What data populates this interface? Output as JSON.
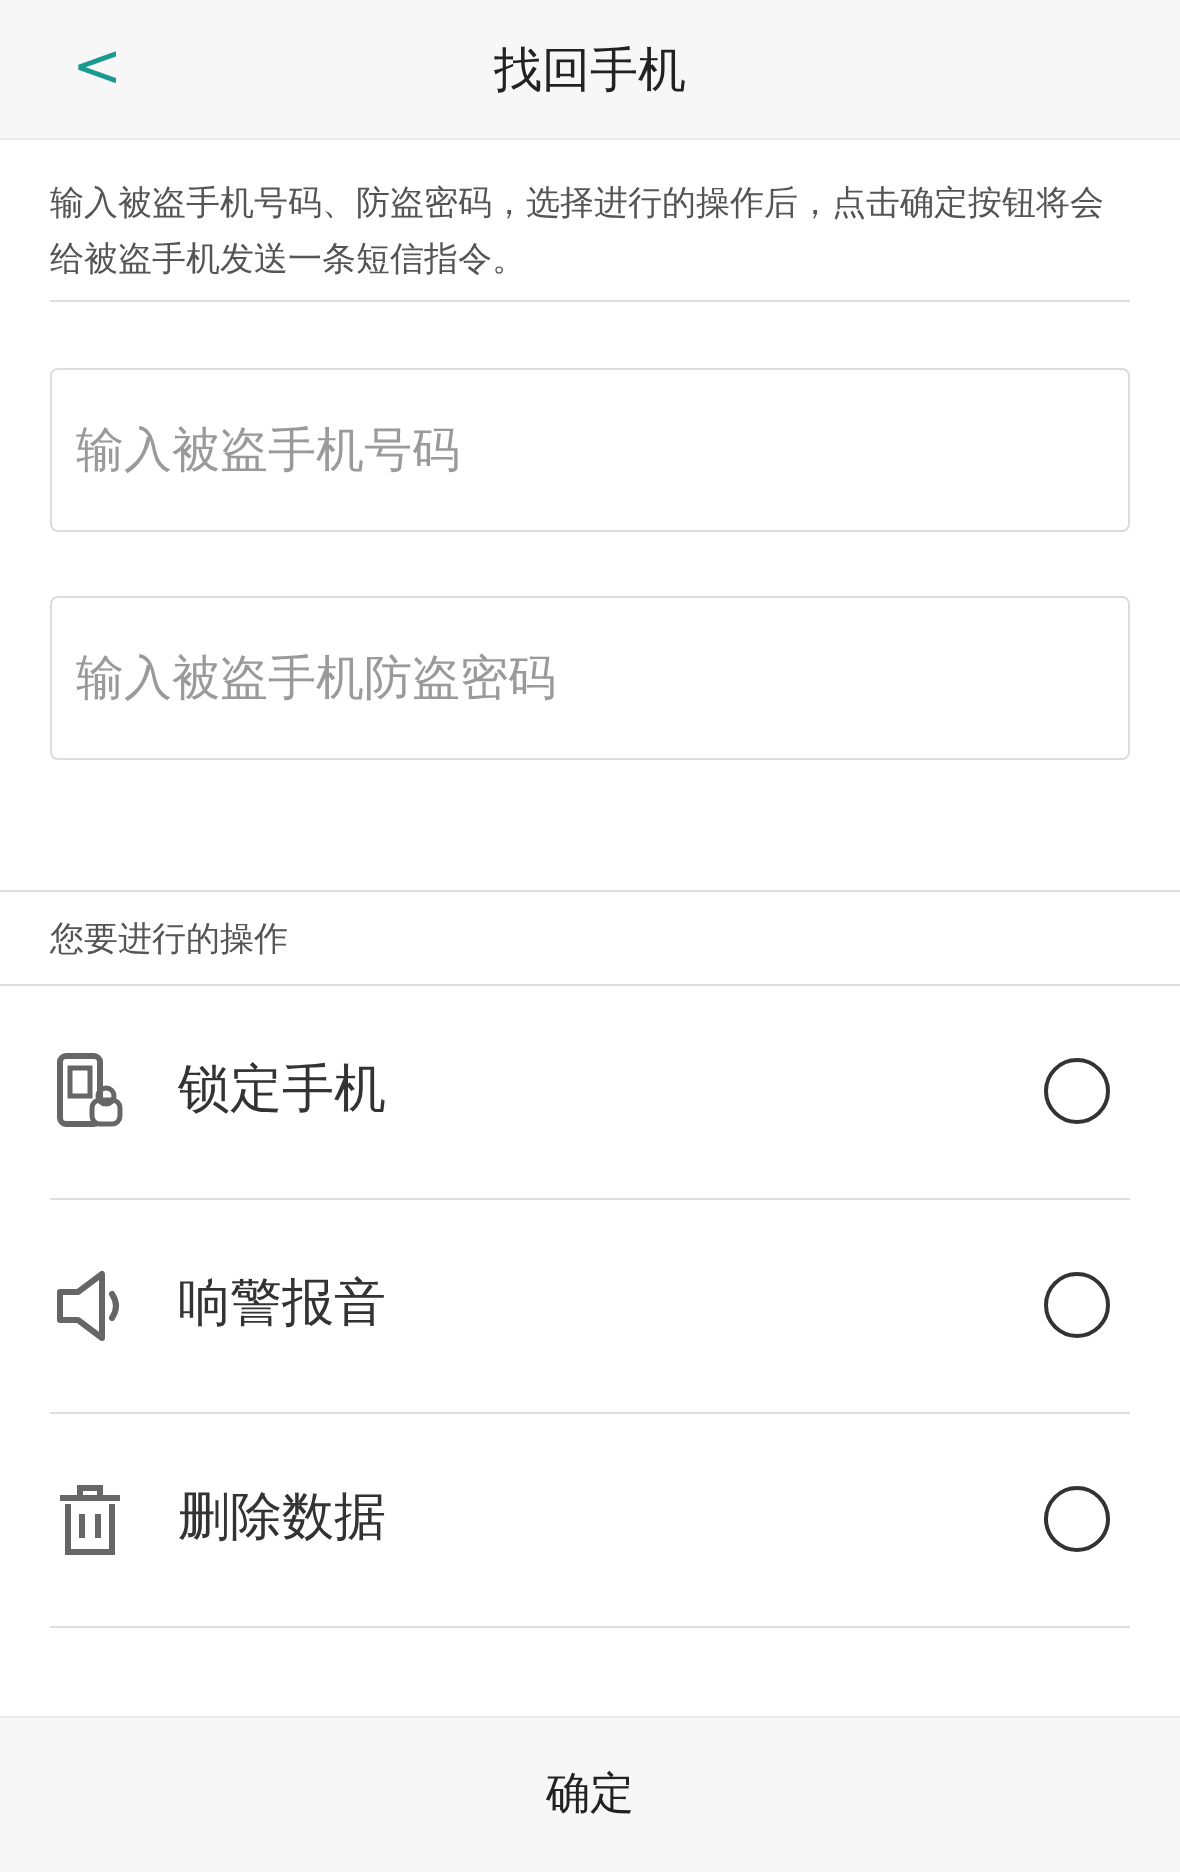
{
  "header": {
    "back": "<",
    "title": "找回手机"
  },
  "intro": "输入被盗手机号码、防盗密码，选择进行的操作后，点击确定按钮将会给被盗手机发送一条短信指令。",
  "fields": [
    {
      "placeholder": "输入被盗手机号码"
    },
    {
      "placeholder": "输入被盗手机防盗密码"
    }
  ],
  "section_label": "您要进行的操作",
  "options": [
    {
      "kind": "lock",
      "label": "锁定手机",
      "selected": false
    },
    {
      "kind": "alarm",
      "label": "响警报音",
      "selected": false
    },
    {
      "kind": "erase",
      "label": "删除数据",
      "selected": false
    }
  ],
  "confirm": "确定"
}
